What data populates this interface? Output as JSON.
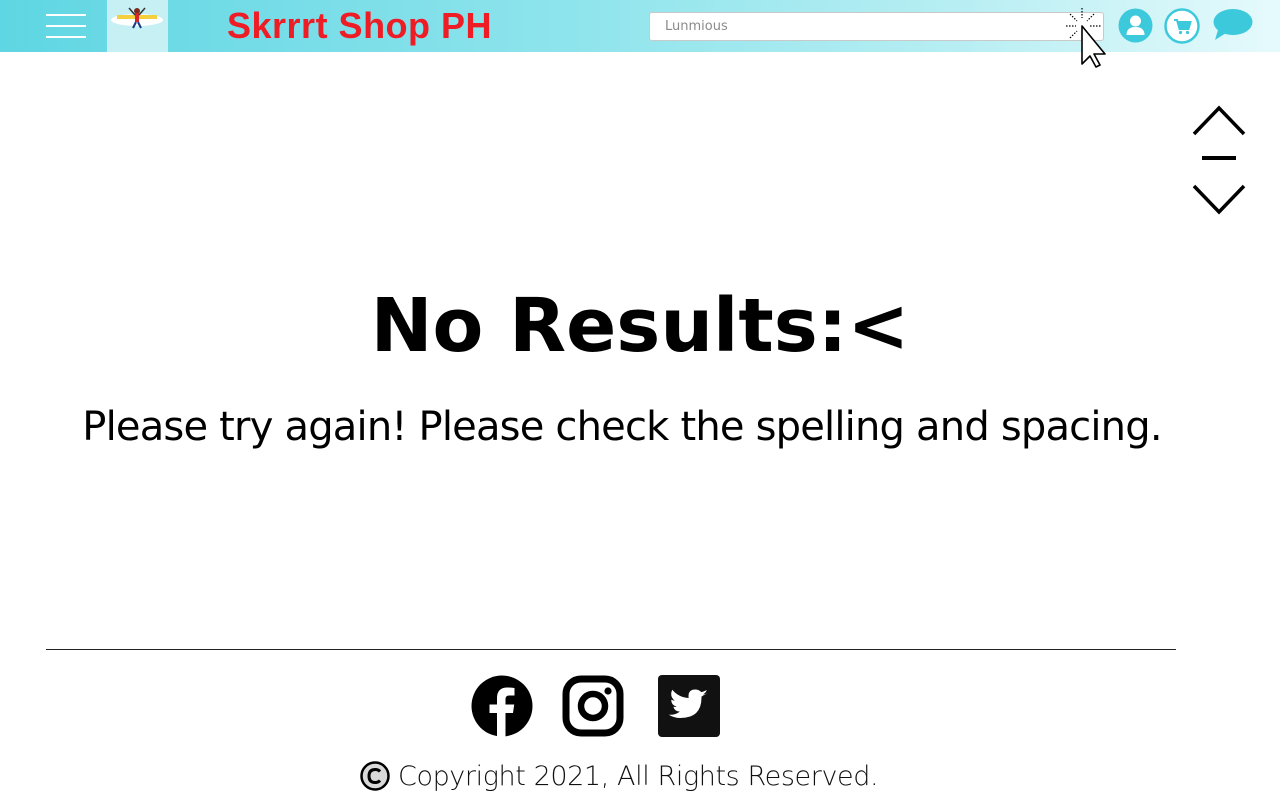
{
  "header": {
    "site_title": "Skrrrt Shop PH",
    "search_value": "Lunmious",
    "title_color": "#ee1c24",
    "bar_color": "#5fd6e3",
    "icons": [
      "menu-icon",
      "user-icon",
      "cart-icon",
      "chat-icon"
    ]
  },
  "side_controls": {
    "icons": [
      "chevron-up-icon",
      "dash-icon",
      "chevron-down-icon"
    ]
  },
  "main": {
    "heading": "No Results:<",
    "message": "Please try again! Please check the spelling and spacing."
  },
  "footer": {
    "social_icons": [
      "facebook-icon",
      "instagram-icon",
      "twitter-icon"
    ],
    "copyright": "Copyright 2021, All Rights Reserved."
  }
}
